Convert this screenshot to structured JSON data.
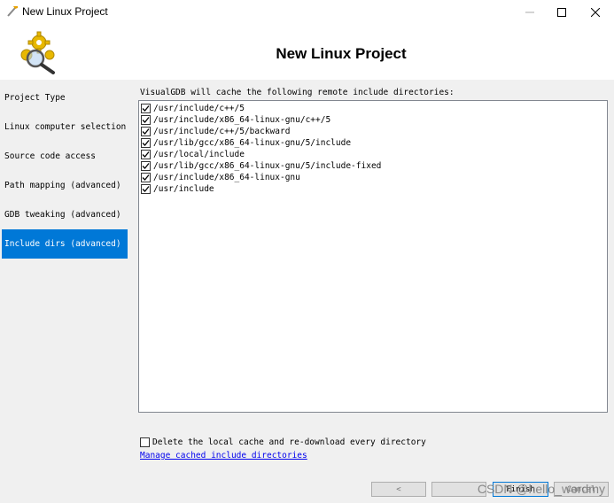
{
  "window": {
    "title": "New Linux Project"
  },
  "header": {
    "title": "New Linux Project",
    "logo_icon": "gear-magnifier-icon"
  },
  "sidebar": {
    "items": [
      {
        "label": "Project Type",
        "active": false
      },
      {
        "label": "Linux computer selection",
        "active": false
      },
      {
        "label": "Source code access",
        "active": false
      },
      {
        "label": "Path mapping (advanced)",
        "active": false
      },
      {
        "label": "GDB tweaking (advanced)",
        "active": false
      },
      {
        "label": "Include dirs (advanced)",
        "active": true
      }
    ]
  },
  "main": {
    "intro": "VisualGDB will cache the following remote include directories:",
    "directories": [
      {
        "path": "/usr/include/c++/5",
        "checked": true
      },
      {
        "path": "/usr/include/x86_64-linux-gnu/c++/5",
        "checked": true
      },
      {
        "path": "/usr/include/c++/5/backward",
        "checked": true
      },
      {
        "path": "/usr/lib/gcc/x86_64-linux-gnu/5/include",
        "checked": true
      },
      {
        "path": "/usr/local/include",
        "checked": true
      },
      {
        "path": "/usr/lib/gcc/x86_64-linux-gnu/5/include-fixed",
        "checked": true
      },
      {
        "path": "/usr/include/x86_64-linux-gnu",
        "checked": true
      },
      {
        "path": "/usr/include",
        "checked": true
      }
    ],
    "delete_cache_label": "Delete the local cache and re-download every directory",
    "delete_cache_checked": false,
    "manage_link": "Manage cached include directories"
  },
  "footer": {
    "back_label": "<",
    "finish_label": "Finish",
    "cancel_label": "Cancel"
  },
  "watermark": "CSDN @hello_wordmy",
  "colors": {
    "accent": "#0078d7",
    "panel": "#f0f0f0",
    "link": "#0000ee"
  }
}
